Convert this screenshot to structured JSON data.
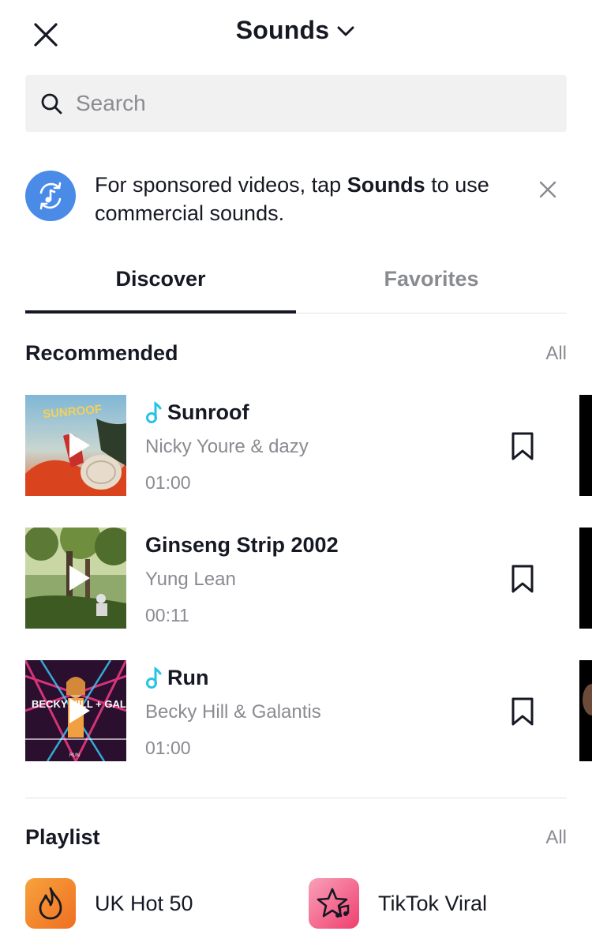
{
  "header": {
    "title": "Sounds"
  },
  "search": {
    "placeholder": "Search"
  },
  "banner": {
    "text_before": "For sponsored videos, tap ",
    "text_bold": "Sounds",
    "text_after": " to use commercial sounds."
  },
  "tabs": [
    {
      "label": "Discover",
      "active": true
    },
    {
      "label": "Favorites",
      "active": false
    }
  ],
  "recommended": {
    "title": "Recommended",
    "all_label": "All",
    "songs": [
      {
        "title": "Sunroof",
        "artist": "Nicky Youre & dazy",
        "duration": "01:00",
        "commercial": true,
        "thumb_text": "SUNROOF"
      },
      {
        "title": "Ginseng Strip 2002",
        "artist": "Yung Lean",
        "duration": "00:11",
        "commercial": false
      },
      {
        "title": "Run",
        "artist": "Becky Hill & Galantis",
        "duration": "01:00",
        "commercial": true,
        "thumb_text": "BECKY HILL + GALANTIS",
        "thumb_sub": "RUN"
      }
    ]
  },
  "playlist": {
    "title": "Playlist",
    "all_label": "All",
    "items": [
      {
        "label": "UK Hot 50",
        "icon": "flame-icon",
        "color": "#f5862e"
      },
      {
        "label": "TikTok Viral",
        "icon": "star-music-icon",
        "color": "#f14a78"
      }
    ]
  },
  "colors": {
    "accent_blue": "#4a8be8",
    "note_cyan": "#25c4e6",
    "text_primary": "#161823",
    "text_secondary": "#8a8b91"
  }
}
